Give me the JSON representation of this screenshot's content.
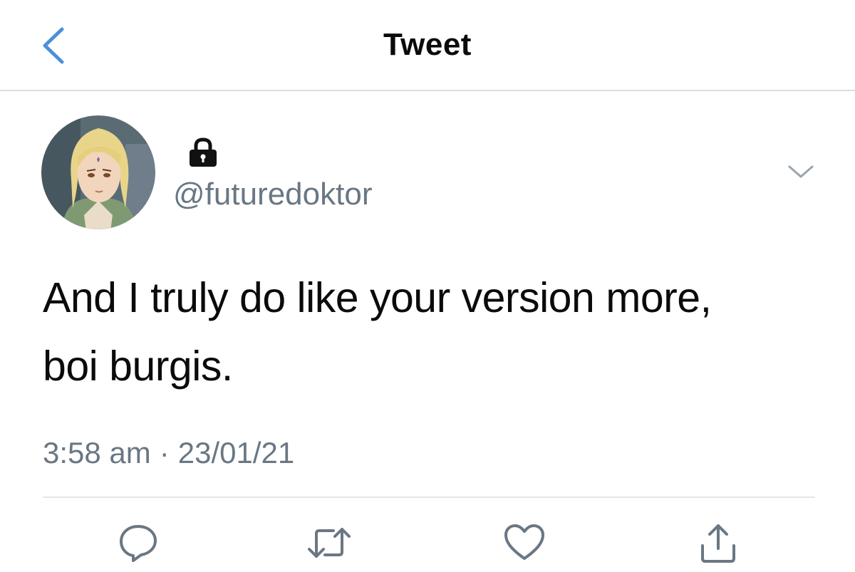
{
  "header": {
    "title": "Tweet",
    "back_icon": "chevron-left-icon",
    "back_color": "#4a90d9"
  },
  "tweet": {
    "author": {
      "avatar_icon": "avatar-image",
      "protected_icon": "lock-icon",
      "handle": "@futuredoktor"
    },
    "menu_icon": "chevron-down-icon",
    "text_line1": "And I truly do like your version more,",
    "text_line2": "boi burgis.",
    "time": "3:58 am",
    "separator": "·",
    "date": "23/01/21"
  },
  "actions": [
    {
      "icon": "reply-icon"
    },
    {
      "icon": "retweet-icon"
    },
    {
      "icon": "like-icon"
    },
    {
      "icon": "share-icon"
    }
  ],
  "colors": {
    "text": "#0b0b0b",
    "secondary": "#6a7783",
    "divider": "#e3e6e9",
    "icon": "#6a7783"
  }
}
